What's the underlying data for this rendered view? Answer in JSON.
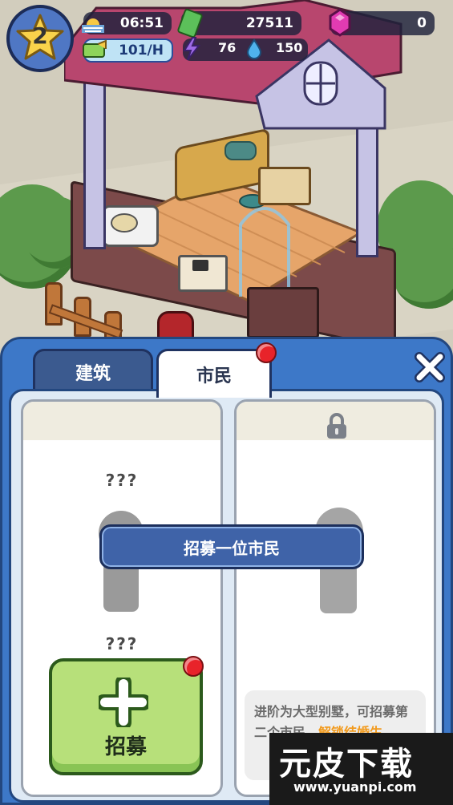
{
  "hud": {
    "level": "2",
    "time": "06:51",
    "rate": "101/H",
    "cash": "27511",
    "gems": "0",
    "energy": "76",
    "water": "150"
  },
  "panel": {
    "tabs": [
      {
        "label": "建筑",
        "active": false
      },
      {
        "label": "市民",
        "active": true,
        "badge": true
      }
    ]
  },
  "slots": {
    "left": {
      "name_top": "???",
      "name_bottom": "???",
      "recruit_label": "招募"
    },
    "banner": "招募一位市民",
    "right": {
      "hint_black": "进阶为大型别墅，可招募第二个市民，",
      "hint_orange": "解锁结婚生"
    }
  },
  "watermark": {
    "title": "元皮下载",
    "url": "www.yuanpi.com"
  },
  "colors": {
    "panel_blue": "#3d78c8",
    "tab_dark": "#3b5a8f",
    "recruit_green": "#b7e07a",
    "banner_blue": "#3f63a8",
    "badge_red": "#e8232a",
    "gem_pink": "#e23bb2",
    "hint_orange": "#f29a1c"
  }
}
